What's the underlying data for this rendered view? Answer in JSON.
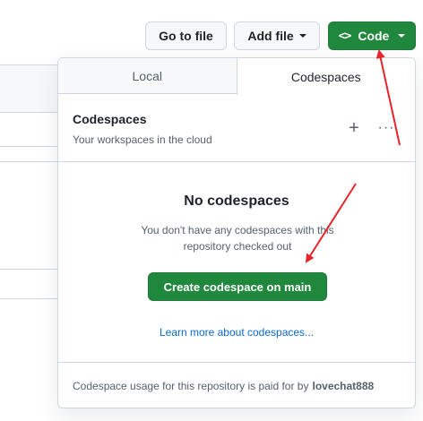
{
  "toolbar": {
    "go_to_file": "Go to file",
    "add_file": "Add file",
    "code": "Code",
    "code_icon": "<>"
  },
  "popover": {
    "tabs": [
      {
        "label": "Local"
      },
      {
        "label": "Codespaces"
      }
    ],
    "header": {
      "title": "Codespaces",
      "subtitle": "Your workspaces in the cloud",
      "plus": "+",
      "kebab": "···"
    },
    "empty": {
      "title": "No codespaces",
      "description": "You don't have any codespaces with this repository checked out",
      "create_button": "Create codespace on main",
      "learn_more": "Learn more about codespaces..."
    },
    "footer": {
      "text": "Codespace usage for this repository is paid for by",
      "owner": "lovechat888"
    }
  },
  "colors": {
    "primary_green": "#1f883d",
    "link_blue": "#0969da",
    "annotation_red": "#e8242b"
  }
}
